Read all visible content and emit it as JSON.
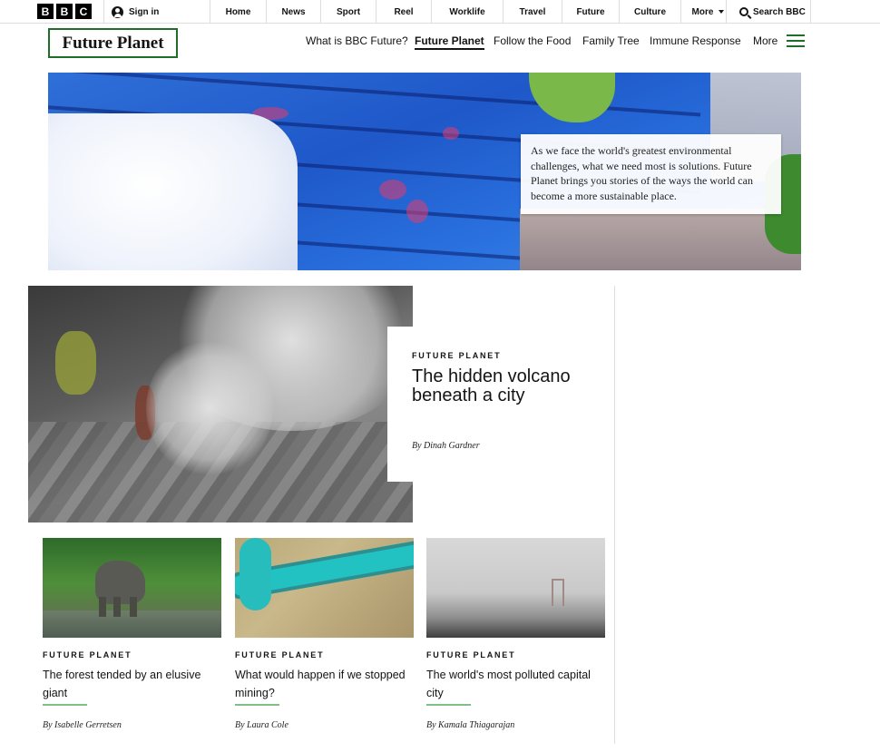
{
  "global_nav": {
    "logo_letters": [
      "B",
      "B",
      "C"
    ],
    "sign_in": "Sign in",
    "items": [
      "Home",
      "News",
      "Sport",
      "Reel",
      "Worklife",
      "Travel",
      "Future",
      "Culture",
      "More"
    ],
    "search": "Search BBC"
  },
  "section": {
    "logo": "Future Planet",
    "nav": [
      "What is BBC Future?",
      "Future Planet",
      "Follow the Food",
      "Family Tree",
      "Immune Response"
    ],
    "active": "Future Planet",
    "more": "More"
  },
  "hero": {
    "description": "As we face the world's greatest environmental challenges, what we need most is solutions. Future Planet brings you stories of the ways the world can become a more sustainable place."
  },
  "lead_story": {
    "kicker": "FUTURE PLANET",
    "title": "The hidden volcano beneath a city",
    "byline": "By Dinah Gardner"
  },
  "stories": [
    {
      "kicker": "FUTURE PLANET",
      "title": "The forest tended by an elusive giant",
      "byline": "By Isabelle Gerretsen"
    },
    {
      "kicker": "FUTURE PLANET",
      "title": "What would happen if we stopped mining?",
      "byline": "By Laura Cole"
    },
    {
      "kicker": "FUTURE PLANET",
      "title": "The world's most polluted capital city",
      "byline": "By Kamala Thiagarajan"
    }
  ],
  "colors": {
    "accent_green": "#1e6e2a",
    "card_rule": "#7fbf8a"
  },
  "icons": {
    "sign_in": "user-icon",
    "search": "search-icon",
    "more_menu": "hamburger-icon",
    "more_dropdown": "caret-down-icon"
  }
}
